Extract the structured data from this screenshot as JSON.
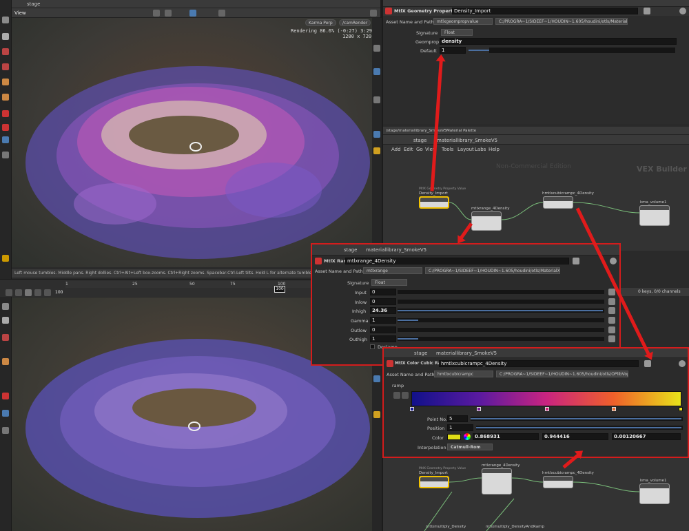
{
  "top_viewport": {
    "stage_tab": "stage",
    "view_label": "View",
    "camera_menu": "Karma Perp",
    "render_menu": "/camRender",
    "render_status": "Rendering  86.6%  (-0:27)  3:29",
    "resolution": "1280 x 720",
    "help_text": "Left mouse tumbles. Middle pans. Right dollies. Ctrl+Alt+Left box-zooms. Ctrl+Right zooms. Spacebar-Ctrl-Left tilts. Hold L for alternate tumble, dolly, and zoom.   M or"
  },
  "timeline": {
    "frame": "100",
    "start": "1",
    "ticks": [
      "1",
      "25",
      "50",
      "75",
      "100"
    ],
    "current_frame": "100",
    "keys_info": "0 keys, 0/0 channels"
  },
  "geomprop_panel": {
    "title": "MtlX Geometry Property Value",
    "node_name": "Density_Import",
    "asset_label": "Asset Name and Path",
    "asset_name": "mtlxgeompropvalue",
    "asset_path": "C:/PROGRA~1/SIDEEF~1/HOUDIN~1.605/houdini/otls/MaterialX.hda",
    "signature_label": "Signature",
    "signature": "Float",
    "geomprop_label": "Geomprop",
    "geomprop": "density",
    "default_label": "Default",
    "default": "1"
  },
  "network_top": {
    "path_tab": "/stage/materiallibrary_SmokeV5",
    "palette_tab": "Material Palette",
    "stage_btn": "stage",
    "lib_btn": "materiallibrary_SmokeV5",
    "menu": [
      "Add",
      "Edit",
      "Go",
      "View",
      "Tools",
      "Layout",
      "Labs",
      "Help"
    ],
    "watermark": "Non-Commercial Edition",
    "builder": "VEX Builder",
    "nodes": [
      {
        "title": "MtlX Geometry Property Value",
        "name": "Density_Import"
      },
      {
        "title": "",
        "name": "mtlxrange_4Density"
      },
      {
        "title": "",
        "name": "hmtlxcubicrampc_4Density"
      },
      {
        "title": "",
        "name": "kma_volume1"
      }
    ]
  },
  "range_panel": {
    "stage_btn": "stage",
    "lib_btn": "materiallibrary_SmokeV5",
    "title": "MtlX Range",
    "node_name": "mtlxrange_4Density",
    "asset_label": "Asset Name and Path",
    "asset_name": "mtlxrange",
    "asset_path": "C:/PROGRA~1/SIDEEF~1/HOUDIN~1.605/houdini/otls/MaterialX.hda",
    "params": [
      {
        "label": "Signature",
        "value": "Float"
      },
      {
        "label": "Input",
        "value": "0"
      },
      {
        "label": "Inlow",
        "value": "0"
      },
      {
        "label": "Inhigh",
        "value": "24.36"
      },
      {
        "label": "Gamma",
        "value": "1"
      },
      {
        "label": "Outlow",
        "value": "0"
      },
      {
        "label": "Outhigh",
        "value": "1"
      }
    ],
    "doclamp": "Doclamp"
  },
  "ramp_panel": {
    "stage_btn": "stage",
    "lib_btn": "materiallibrary_SmokeV5",
    "title": "MtlX Color Cubic Ramp",
    "node_name": "hmtlxcubicrampc_4Density",
    "asset_label": "Asset Name and Path",
    "asset_name": "hmtlxcubicrampc",
    "asset_path": "C:/PROGRA~1/SIDEEF~1/HOUDIN~1.605/houdini/otls/OPlibVop.hda",
    "ramp_label": "ramp",
    "point_no_label": "Point No.",
    "point_no": "5",
    "position_label": "Position",
    "position": "1",
    "color_label": "Color",
    "color_r": "0.868931",
    "color_g": "0.944416",
    "color_b": "0.00120667",
    "interp_label": "Interpolation",
    "interp": "Catmull-Rom",
    "ramp_colors": [
      "#1a1aa0",
      "#7a1a9a",
      "#d4207a",
      "#f06a2a",
      "#e9e31a"
    ]
  },
  "network_bottom": {
    "nodes": [
      {
        "title": "MtlX Geometry Property Value",
        "name": "Density_Import"
      },
      {
        "title": "",
        "name": "mtlxrange_4Density"
      },
      {
        "title": "",
        "name": "hmtlxcubicrampc_4Density"
      },
      {
        "title": "",
        "name": "kma_volume1"
      },
      {
        "title": "",
        "name": "mtlxmultiply_Density"
      },
      {
        "title": "",
        "name": "mtlxmultiply_DensityAndRamp"
      }
    ]
  }
}
